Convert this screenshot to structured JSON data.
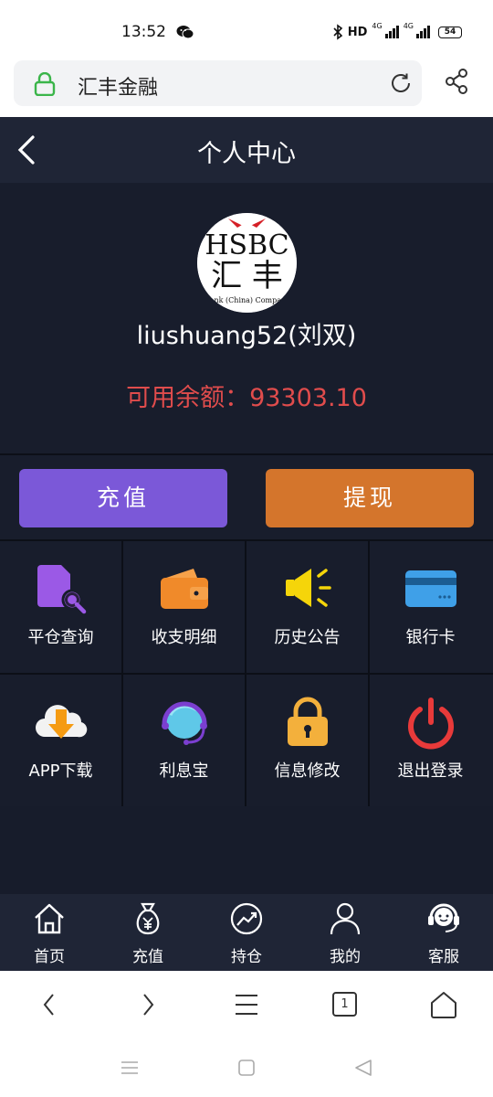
{
  "status_bar": {
    "time": "13:52",
    "hd": "HD",
    "net1": "4G",
    "net2": "4G",
    "battery": "54"
  },
  "browser": {
    "url_title": "汇丰金融"
  },
  "header": {
    "title": "个人中心"
  },
  "profile": {
    "username": "liushuang52(刘双)",
    "balance_label": "可用余额：",
    "balance_value": "93303.10",
    "logo": {
      "brand": "HSBC",
      "chinese": "汇 丰",
      "subtext": "HSBC Bank (China) Company Limited"
    }
  },
  "actions": {
    "recharge": "充值",
    "withdraw": "提现"
  },
  "grid_items": [
    {
      "label": "平仓查询",
      "icon": "search-document-icon",
      "color": "#9b59e6"
    },
    {
      "label": "收支明细",
      "icon": "wallet-icon",
      "color": "#f08a2a"
    },
    {
      "label": "历史公告",
      "icon": "megaphone-icon",
      "color": "#f5d50a"
    },
    {
      "label": "银行卡",
      "icon": "bank-card-icon",
      "color": "#3fa0e8"
    },
    {
      "label": "APP下载",
      "icon": "cloud-download-icon",
      "color": "#f59b12"
    },
    {
      "label": "利息宝",
      "icon": "headset-globe-icon",
      "color": "#5fc8e8"
    },
    {
      "label": "信息修改",
      "icon": "padlock-icon",
      "color": "#f3b03c"
    },
    {
      "label": "退出登录",
      "icon": "power-icon",
      "color": "#e83a3a"
    }
  ],
  "tabbar": [
    {
      "label": "首页",
      "icon": "home-icon"
    },
    {
      "label": "充值",
      "icon": "money-bag-icon"
    },
    {
      "label": "持仓",
      "icon": "chart-trend-icon"
    },
    {
      "label": "我的",
      "icon": "user-icon"
    },
    {
      "label": "客服",
      "icon": "customer-service-icon"
    }
  ],
  "browser_nav": {
    "tab_count": "1"
  },
  "colors": {
    "app_bg": "#171c2b",
    "header_bg": "#1f2536",
    "balance": "#e04c4c",
    "recharge_btn": "#7b58d8",
    "withdraw_btn": "#d4752c"
  }
}
